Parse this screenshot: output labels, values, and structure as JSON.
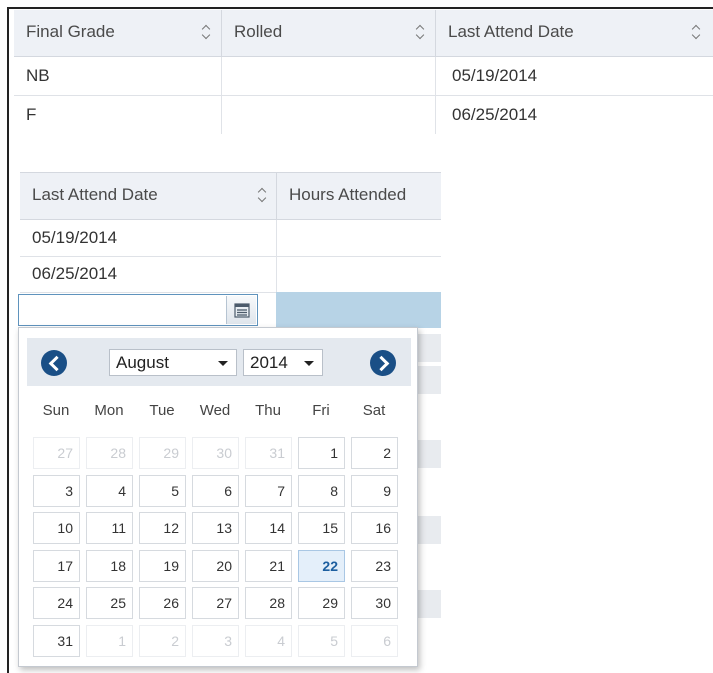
{
  "top_table": {
    "headers": [
      "Final Grade",
      "Rolled",
      "Last Attend Date"
    ],
    "rows": [
      [
        "NB",
        "",
        "05/19/2014"
      ],
      [
        "F",
        "",
        "06/25/2014"
      ]
    ]
  },
  "second_table": {
    "headers": [
      "Last Attend Date",
      "Hours Attended"
    ],
    "rows": [
      [
        "05/19/2014",
        ""
      ],
      [
        "06/25/2014",
        ""
      ]
    ]
  },
  "date_input": {
    "value": "",
    "button_icon": "calendar-icon"
  },
  "datepicker": {
    "month": "August",
    "year": "2014",
    "weekdays": [
      "Sun",
      "Mon",
      "Tue",
      "Wed",
      "Thu",
      "Fri",
      "Sat"
    ],
    "weeks": [
      [
        "27",
        "28",
        "29",
        "30",
        "31",
        "1",
        "2"
      ],
      [
        "3",
        "4",
        "5",
        "6",
        "7",
        "8",
        "9"
      ],
      [
        "10",
        "11",
        "12",
        "13",
        "14",
        "15",
        "16"
      ],
      [
        "17",
        "18",
        "19",
        "20",
        "21",
        "22",
        "23"
      ],
      [
        "24",
        "25",
        "26",
        "27",
        "28",
        "29",
        "30"
      ],
      [
        "31",
        "1",
        "2",
        "3",
        "4",
        "5",
        "6"
      ]
    ],
    "today": "22",
    "colors": {
      "nav": "#1a4f86",
      "today_bg": "#e4effa",
      "row_selected": "#b7d3e6"
    }
  }
}
